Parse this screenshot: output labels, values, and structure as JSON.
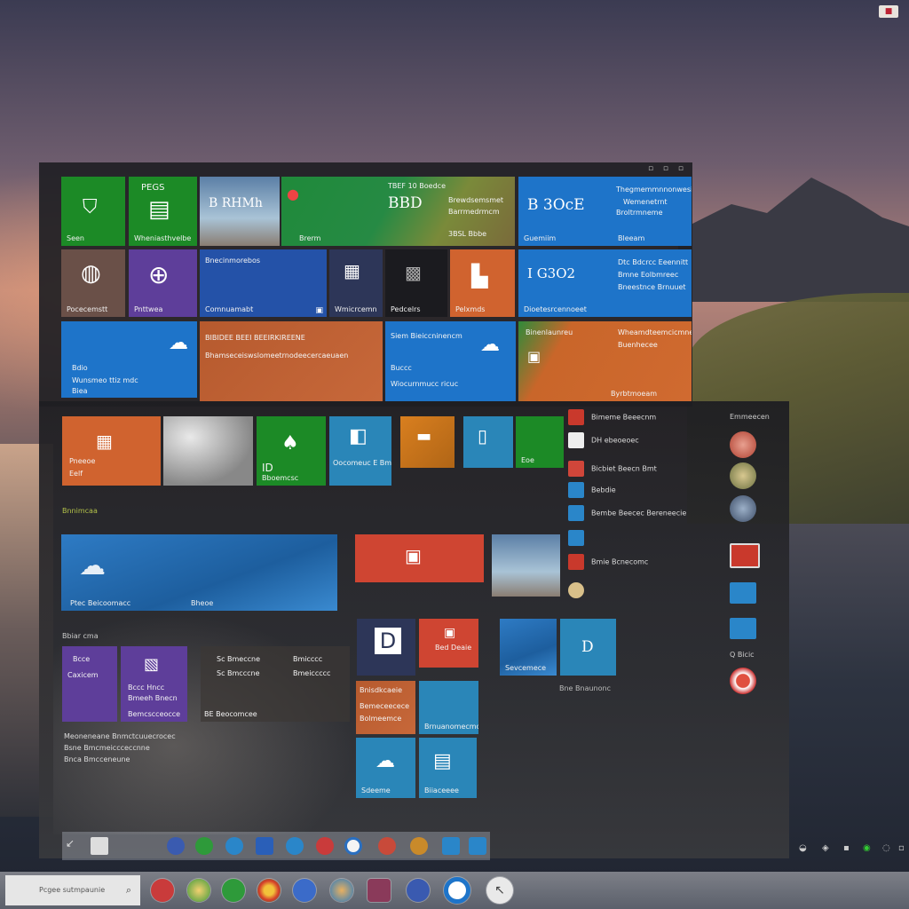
{
  "system": {
    "corner_icon": "notification-icon"
  },
  "upper": {
    "tiles": [
      {
        "id": "store",
        "label": "Seen",
        "icon": "shield-icon"
      },
      {
        "id": "mail",
        "title": "PEGS",
        "label": "Wheniasthvelbe"
      },
      {
        "id": "photo1",
        "title": "B RHMh"
      },
      {
        "id": "news",
        "line1": "TBEF   10  Boedce",
        "line2": "Brewdsemsmet",
        "line3": "Barrmedrmcm",
        "line4": "3BSL  Bbbe",
        "big": "BBD",
        "label": "Brerm"
      },
      {
        "id": "weather-wide",
        "big": "B 3OcE",
        "line1": "Thegmemmnnonwesid",
        "line2": "Wemenetrnt",
        "line3": "Broltrmneme",
        "label_left": "Guemiim",
        "label_right": "Bleeam"
      },
      {
        "id": "globe1",
        "label": "Pocecemstt"
      },
      {
        "id": "globe2",
        "label": "Pnttwea"
      },
      {
        "id": "calendar",
        "text": "Bnecinmorebos",
        "label": "Comnuamabt"
      },
      {
        "id": "people",
        "label": "Wmicrcemn"
      },
      {
        "id": "xbox",
        "label": "Pedcelrs"
      },
      {
        "id": "office",
        "label": "Pelxmds"
      },
      {
        "id": "finance",
        "big": "I G3O2",
        "line1": "Dtc Bdcrcc Eeennitt",
        "line2": "Bmne Eolbmreec",
        "line3": "Bneestnce Brnuuet",
        "label": "Dioetesrcennoeet"
      },
      {
        "id": "onedrive1",
        "line1": "Bdio",
        "line2": "Wunsmeo ttiz mdc",
        "line3": "Biea"
      },
      {
        "id": "news2",
        "line1": "BIBIDEE BEEI BEEIRKIREENE",
        "line2": "Bhamseceiswslomeetrnodeecercaeuaen"
      },
      {
        "id": "onedrive2",
        "line1": "Siem Bieiccninencm",
        "line2": "Buccc",
        "line3": "Wiocurnmucc ricuc"
      },
      {
        "id": "sports",
        "line1": "Binenlaunreu",
        "line2": "Wheamdteemcicmne",
        "line3": "Buenhecee",
        "label": "Byrbtmoeam"
      }
    ]
  },
  "lower": {
    "tiles": [
      {
        "id": "calc",
        "line1": "Pneeoe",
        "line2": "Eelf"
      },
      {
        "id": "photo-cloud"
      },
      {
        "id": "onedrive3",
        "label": "Bboemcsc",
        "small": "ID"
      },
      {
        "id": "store2",
        "label": "Oocomeuc  E Bmoccecne"
      },
      {
        "id": "amber-tile"
      },
      {
        "id": "teal-tile"
      },
      {
        "id": "green-tile",
        "label": "Eoe"
      },
      {
        "id": "sky-wide",
        "label": "Ptec Beicoomacc",
        "label2": "Bheoe"
      },
      {
        "id": "red-wide"
      },
      {
        "id": "photo-beach"
      },
      {
        "id": "dark-text",
        "line1": "Sc Bmeccne",
        "line2": "Bmicccc",
        "line3": "Sc Bmcccne",
        "line4": "Bmeiccccc",
        "line5": "BE Beocomcee"
      },
      {
        "id": "purple1",
        "line1": "Bcce",
        "line2": "Caxicem"
      },
      {
        "id": "purple2",
        "line1": "Bccc Hncc",
        "line2": "Bmeeh Bnecn",
        "line3": "Bemcscceocce"
      },
      {
        "id": "navy-d"
      },
      {
        "id": "red-s",
        "line1": "Bed Deaie"
      },
      {
        "id": "photo-leaf",
        "label": "Sevcemece"
      },
      {
        "id": "blue-d",
        "label": "D"
      },
      {
        "id": "rust2",
        "line1": "Bnisdkcaeie",
        "line2": "Bemeceecece",
        "line3": "Bolmeemce"
      },
      {
        "id": "blue-paper",
        "label": "Brnuanomecmcm"
      },
      {
        "id": "cloud-s",
        "label": "Sdeeme"
      },
      {
        "id": "news-s",
        "label": "Biiaceeee"
      }
    ],
    "bottom_text": {
      "line1": "Meoneneane Bnmctcuuecrocec",
      "line2": "Bsne Bmcmeiccceccnne",
      "line3": "Bnca Bmcceneune"
    },
    "small_labels": {
      "left_under_sky": "Bbiar cma",
      "under_green": "Bnnimcaa",
      "under_col": "Bne Bnaunonc"
    },
    "list": [
      {
        "text": "Bimeme Beeecnm",
        "color": "#c9392c"
      },
      {
        "text": "DH ebeoeoec",
        "color": "#eeeeee"
      },
      {
        "text": "Bicbiet Beecn Bmt",
        "color": "#d0463a"
      },
      {
        "text": "Bebdie",
        "color": "#2a86c9"
      },
      {
        "text": "Bembe Beecec Bereneecie",
        "color": "#2a86c9"
      },
      {
        "text": "",
        "color": "#2a86c9"
      },
      {
        "text": "Bmie Bcnecomc",
        "color": "#c9392c"
      },
      {
        "text": "",
        "color": "#d9c08a"
      }
    ],
    "right_header": "Emmeecen",
    "right_round_caption": "Q Bicic"
  },
  "inner_taskbar": {
    "items": [
      "back-icon",
      "list-icon",
      "edge-icon",
      "chrome-icon",
      "cloud-icon",
      "word-icon",
      "dropbox-icon",
      "maps-icon",
      "clock-icon",
      "media-icon",
      "globe-icon",
      "skype-icon",
      "store-icon"
    ]
  },
  "taskbar": {
    "search_placeholder": "Pcgee sutmpaunie",
    "apps": [
      "red-app-icon",
      "maps-app-icon",
      "green-app-icon",
      "chrome-app-icon",
      "blue-app-icon",
      "globe-app-icon",
      "gallery-app-icon",
      "grid-app-icon",
      "edge-app-icon",
      "back-app-icon"
    ]
  },
  "tray": [
    "wifi-icon",
    "volume-icon",
    "battery-icon",
    "network-icon",
    "clock-icon",
    "notification-icon"
  ],
  "colors": {
    "accent_blue": "#1e74c9",
    "accent_green": "#1c8a26",
    "accent_orange": "#d0632f",
    "accent_purple": "#5e3e9a"
  }
}
